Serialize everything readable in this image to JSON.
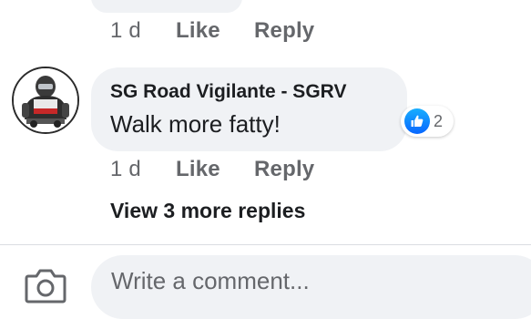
{
  "previous_comment": {
    "time": "1 d",
    "like_label": "Like",
    "reply_label": "Reply"
  },
  "comment": {
    "author": "SG Road Vigilante - SGRV",
    "text": "Walk more fatty!",
    "time": "1 d",
    "like_label": "Like",
    "reply_label": "Reply",
    "reaction": {
      "icon": "thumbs-up-icon",
      "count": "2",
      "color": "#0866ff"
    }
  },
  "view_replies_label": "View 3 more replies",
  "composer": {
    "camera_icon": "camera-icon",
    "placeholder": "Write a comment..."
  }
}
